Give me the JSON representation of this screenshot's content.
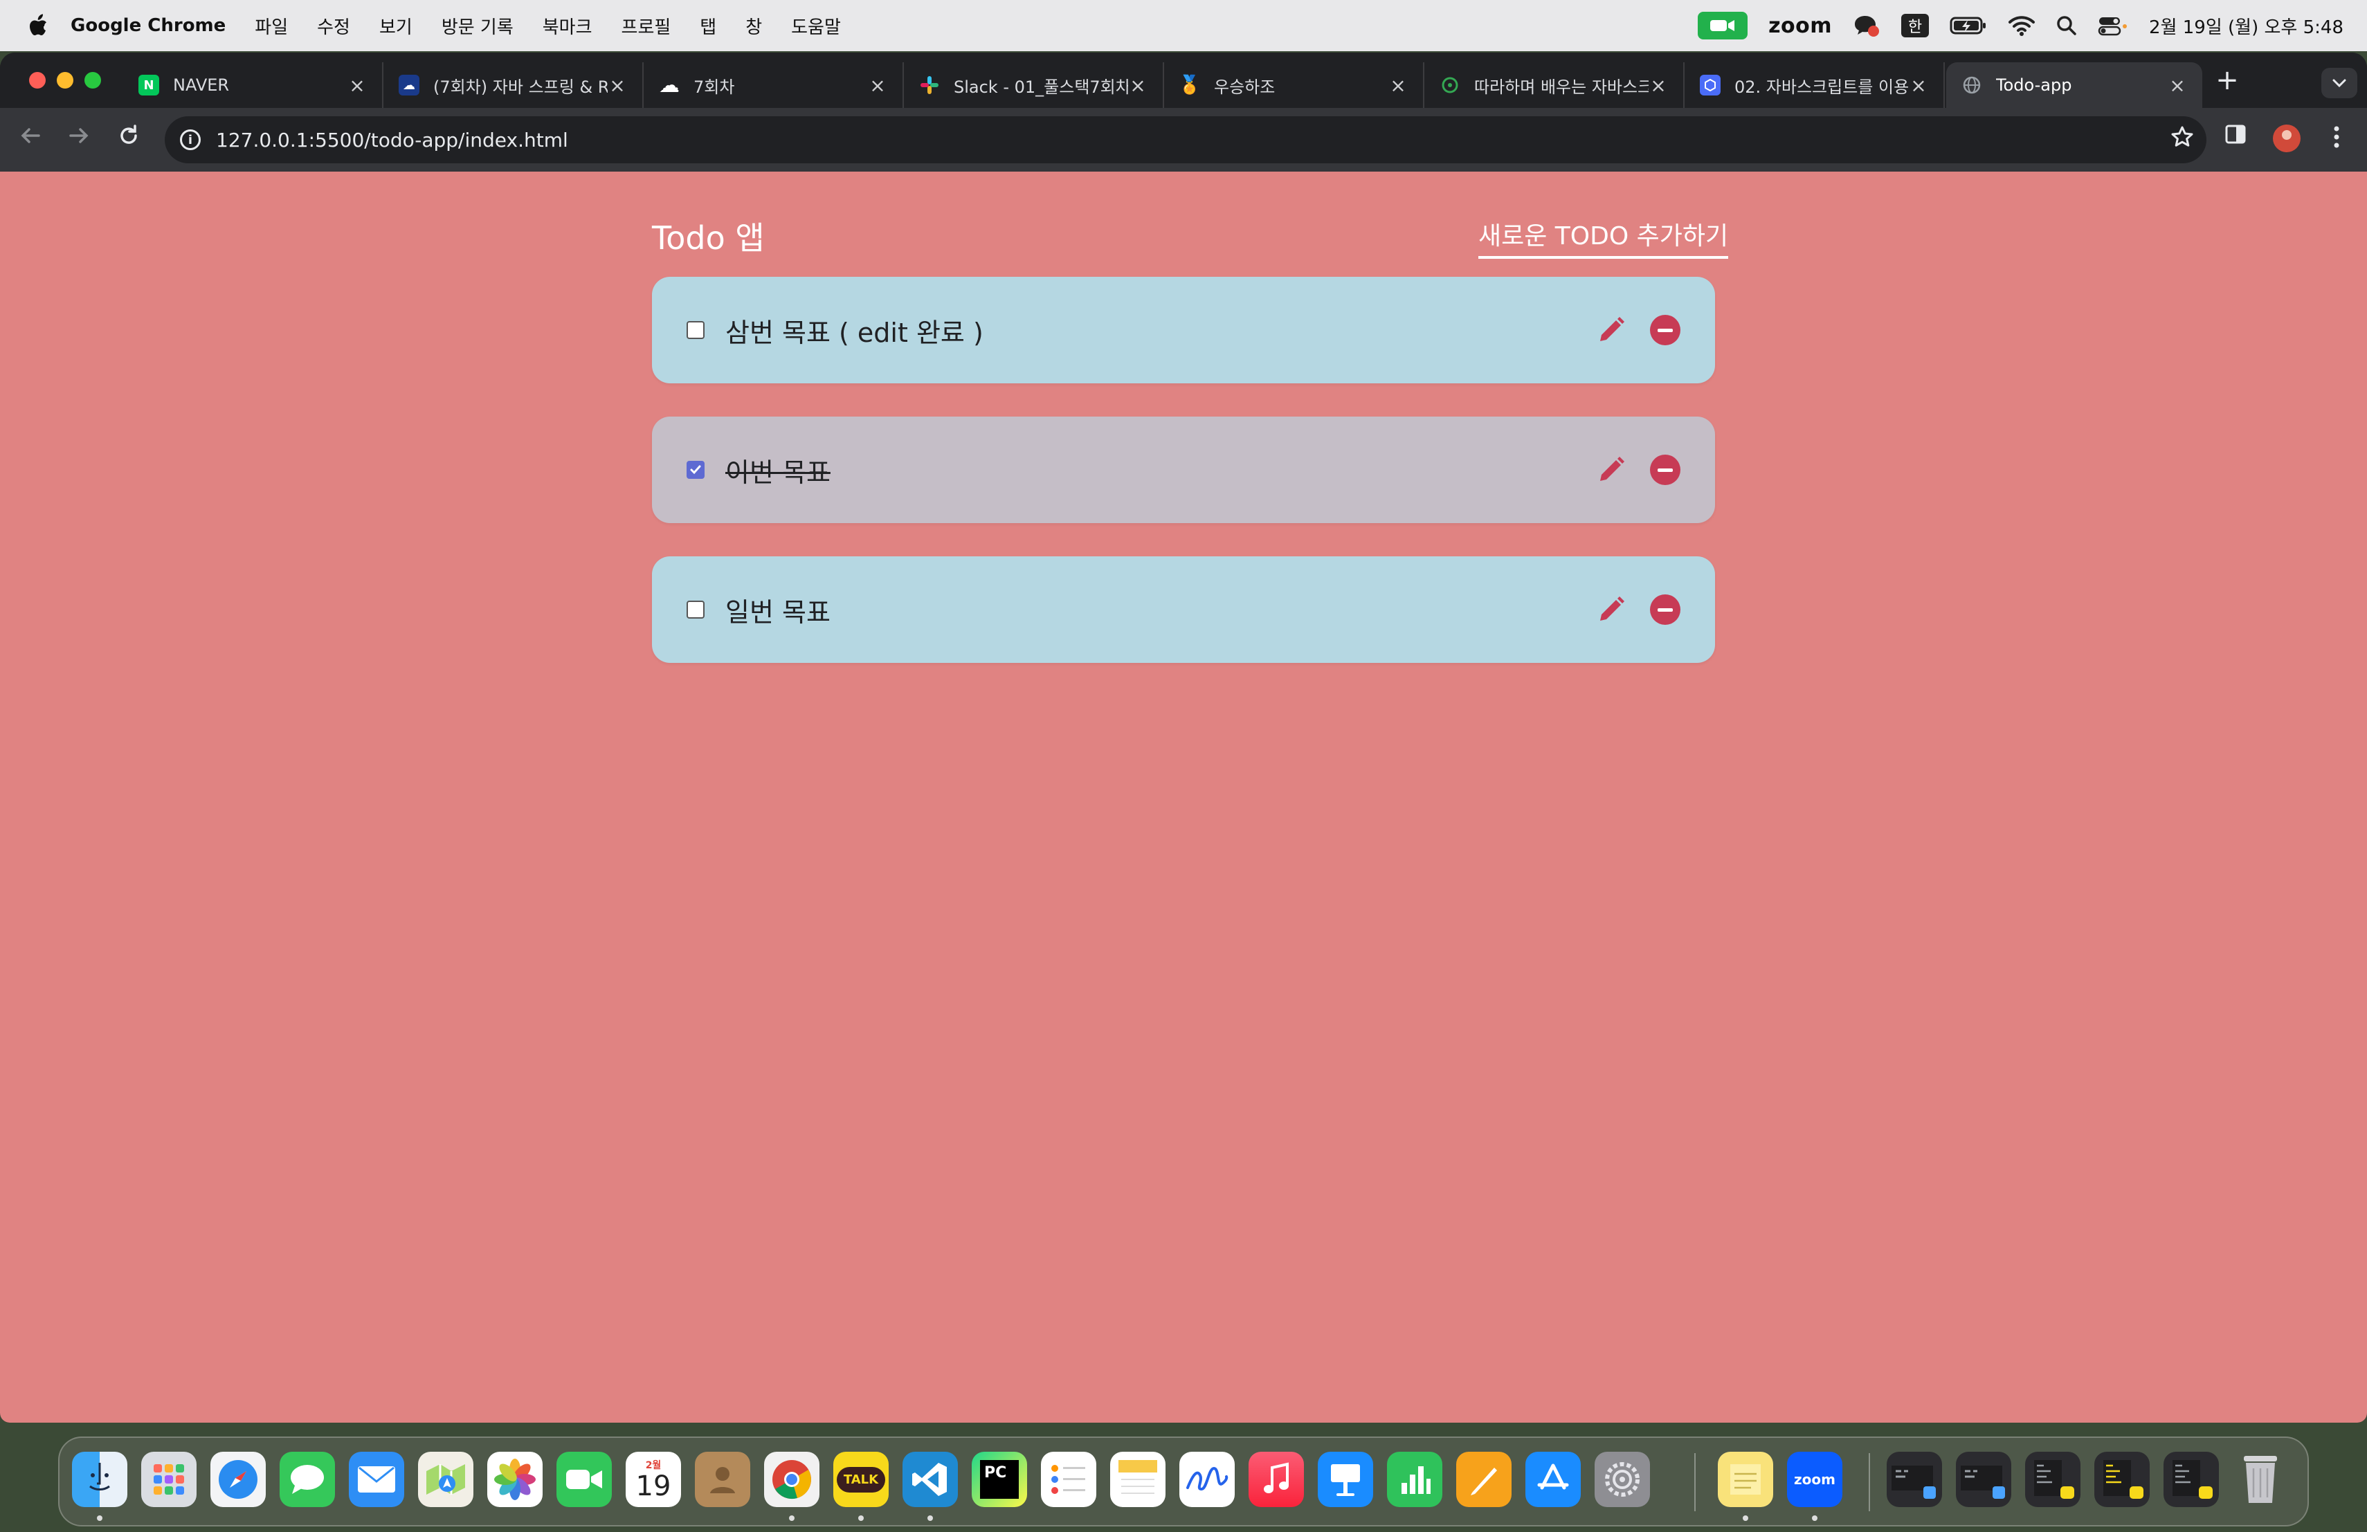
{
  "menubar": {
    "app_name": "Google Chrome",
    "menus": [
      "파일",
      "수정",
      "보기",
      "방문 기록",
      "북마크",
      "프로필",
      "탭",
      "창",
      "도움말"
    ],
    "zoom_label": "zoom",
    "input_method": "한",
    "clock": "2월 19일 (월) 오후 5:48"
  },
  "tabs": [
    {
      "title": "NAVER",
      "favicon": "naver-icon",
      "color": "#03c75a"
    },
    {
      "title": "(7회차) 자바 스프링 & R",
      "favicon": "spring-icon",
      "color": "#1a3a8a"
    },
    {
      "title": "7회차",
      "favicon": "cloud-icon",
      "color": "#ffffff"
    },
    {
      "title": "Slack - 01_풀스택7회차",
      "favicon": "slack-icon",
      "color": "#e01e5a"
    },
    {
      "title": "우승하조",
      "favicon": "trophy-icon",
      "color": "#d4493f"
    },
    {
      "title": "따라하며 배우는 자바스크",
      "favicon": "loop-icon",
      "color": "#34a853"
    },
    {
      "title": "02. 자바스크립트를 이용",
      "favicon": "doc-icon",
      "color": "#4a6cf7"
    },
    {
      "title": "Todo-app",
      "favicon": "globe-icon",
      "color": "#9aa0a6",
      "active": true
    }
  ],
  "address_bar": {
    "url": "127.0.0.1:5500/todo-app/index.html"
  },
  "app": {
    "title": "Todo 앱",
    "add_link": "새로운 TODO 추가하기",
    "todos": [
      {
        "text": "삼번 목표 ( edit 완료 )",
        "done": false
      },
      {
        "text": "이번 목표",
        "done": true
      },
      {
        "text": "일번 목표",
        "done": false
      }
    ]
  },
  "colors": {
    "page_bg": "#e08382",
    "todo_open": "#b5d7e2",
    "todo_done": "#c5bec7",
    "accent": "#c73b55"
  },
  "dock": {
    "calendar_month": "2월",
    "calendar_day": "19",
    "kakaotalk": "TALK",
    "pycharm": "PC",
    "zoom": "zoom"
  }
}
